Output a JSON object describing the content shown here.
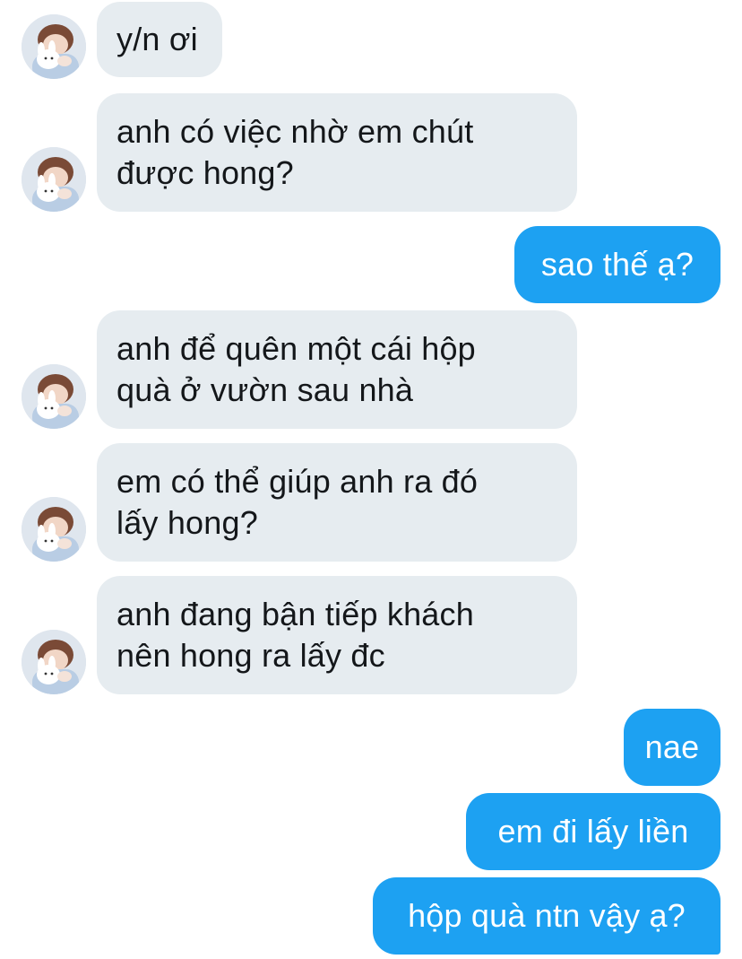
{
  "conversation": {
    "messages": [
      {
        "sender": "them",
        "text": "y/n ơi"
      },
      {
        "sender": "them",
        "text": "anh có việc nhờ em chút\nđược hong?"
      },
      {
        "sender": "me",
        "text": "sao thế ạ?"
      },
      {
        "sender": "them",
        "text": "anh để quên một cái hộp\nquà ở vườn sau nhà"
      },
      {
        "sender": "them",
        "text": "em có thể giúp anh ra đó\nlấy hong?"
      },
      {
        "sender": "them",
        "text": "anh đang bận tiếp khách\nnên hong ra lấy đc"
      },
      {
        "sender": "me",
        "text": "nae"
      },
      {
        "sender": "me",
        "text": "em đi lấy liền"
      },
      {
        "sender": "me",
        "text": "hộp quà ntn vậy ạ?"
      }
    ]
  },
  "colors": {
    "incoming_bubble": "#e6ecf0",
    "outgoing_bubble": "#1da1f2",
    "incoming_text": "#14171a",
    "outgoing_text": "#ffffff"
  },
  "icons": {
    "avatar": "contact-avatar-photo"
  }
}
